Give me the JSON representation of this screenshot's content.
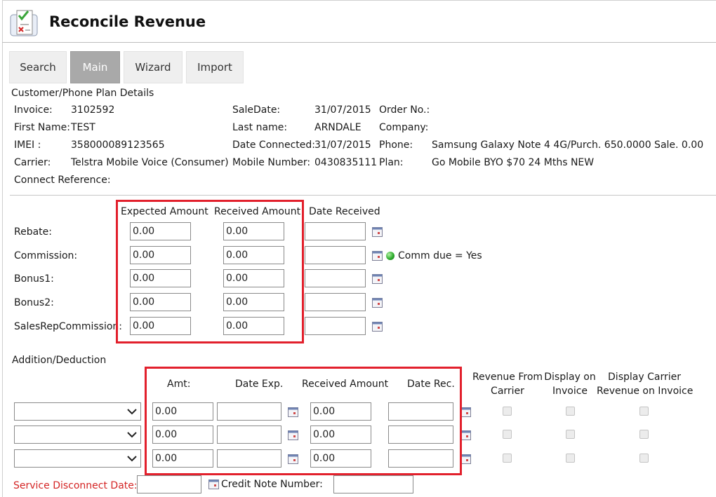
{
  "header": {
    "title": "Reconcile Revenue",
    "icon": "checklist-icon"
  },
  "tabs": [
    {
      "label": "Search",
      "active": false
    },
    {
      "label": "Main",
      "active": true
    },
    {
      "label": "Wizard",
      "active": false
    },
    {
      "label": "Import",
      "active": false
    }
  ],
  "details": {
    "section_title": "Customer/Phone Plan Details",
    "invoice": {
      "label": "Invoice:",
      "value": "3102592"
    },
    "first_name": {
      "label": "First Name:",
      "value": "TEST"
    },
    "imei": {
      "label": "IMEI :",
      "value": "358000089123565"
    },
    "carrier": {
      "label": "Carrier:",
      "value": "Telstra Mobile Voice (Consumer)"
    },
    "connect_reference": {
      "label": "Connect Reference:",
      "value": ""
    },
    "sale_date": {
      "label": "SaleDate:",
      "value": "31/07/2015"
    },
    "last_name": {
      "label": "Last name:",
      "value": "ARNDALE"
    },
    "date_connected": {
      "label": "Date Connected:",
      "value": "31/07/2015"
    },
    "mobile_number": {
      "label": "Mobile Number:",
      "value": "0430835111"
    },
    "order_no": {
      "label": "Order No.:",
      "value": ""
    },
    "company": {
      "label": "Company:",
      "value": ""
    },
    "phone": {
      "label": "Phone:",
      "value": "Samsung Galaxy Note 4 4G/Purch. 650.0000 Sale. 0.00"
    },
    "plan": {
      "label": "Plan:",
      "value": "Go Mobile BYO $70 24 Mths NEW"
    }
  },
  "revenue": {
    "headers": {
      "expected": "Expected Amount",
      "received": "Received Amount",
      "date_received": "Date Received"
    },
    "rows": [
      {
        "label": "Rebate:",
        "expected": "0.00",
        "received": "0.00",
        "date_received": ""
      },
      {
        "label": "Commission:",
        "expected": "0.00",
        "received": "0.00",
        "date_received": ""
      },
      {
        "label": "Bonus1:",
        "expected": "0.00",
        "received": "0.00",
        "date_received": ""
      },
      {
        "label": "Bonus2:",
        "expected": "0.00",
        "received": "0.00",
        "date_received": ""
      },
      {
        "label": "SalesRepCommission:",
        "expected": "0.00",
        "received": "0.00",
        "date_received": ""
      }
    ],
    "comm_due_text": "Comm due = Yes",
    "comm_due_color": "#2fae2f"
  },
  "addition": {
    "section_title": "Addition/Deduction",
    "headers": {
      "amt": "Amt:",
      "date_exp": "Date Exp.",
      "received_amount": "Received Amount",
      "date_rec": "Date Rec.",
      "revenue_from_carrier": [
        "Revenue From",
        "Carrier"
      ],
      "display_on_invoice": [
        "Display on",
        "Invoice"
      ],
      "display_carrier_revenue": [
        "Display Carrier",
        "Revenue on Invoice"
      ]
    },
    "rows": [
      {
        "type": "",
        "amt": "0.00",
        "date_exp": "",
        "received_amount": "0.00",
        "date_rec": ""
      },
      {
        "type": "",
        "amt": "0.00",
        "date_exp": "",
        "received_amount": "0.00",
        "date_rec": ""
      },
      {
        "type": "",
        "amt": "0.00",
        "date_exp": "",
        "received_amount": "0.00",
        "date_rec": ""
      }
    ]
  },
  "footer": {
    "service_disconnect_label": "Service Disconnect Date:",
    "service_disconnect_value": "",
    "credit_note_label": "Credit Note Number:",
    "credit_note_value": ""
  },
  "colors": {
    "highlight_box": "#e2202c",
    "service_disconnect_label": "#d42424",
    "active_tab": "#a9a9a9"
  }
}
